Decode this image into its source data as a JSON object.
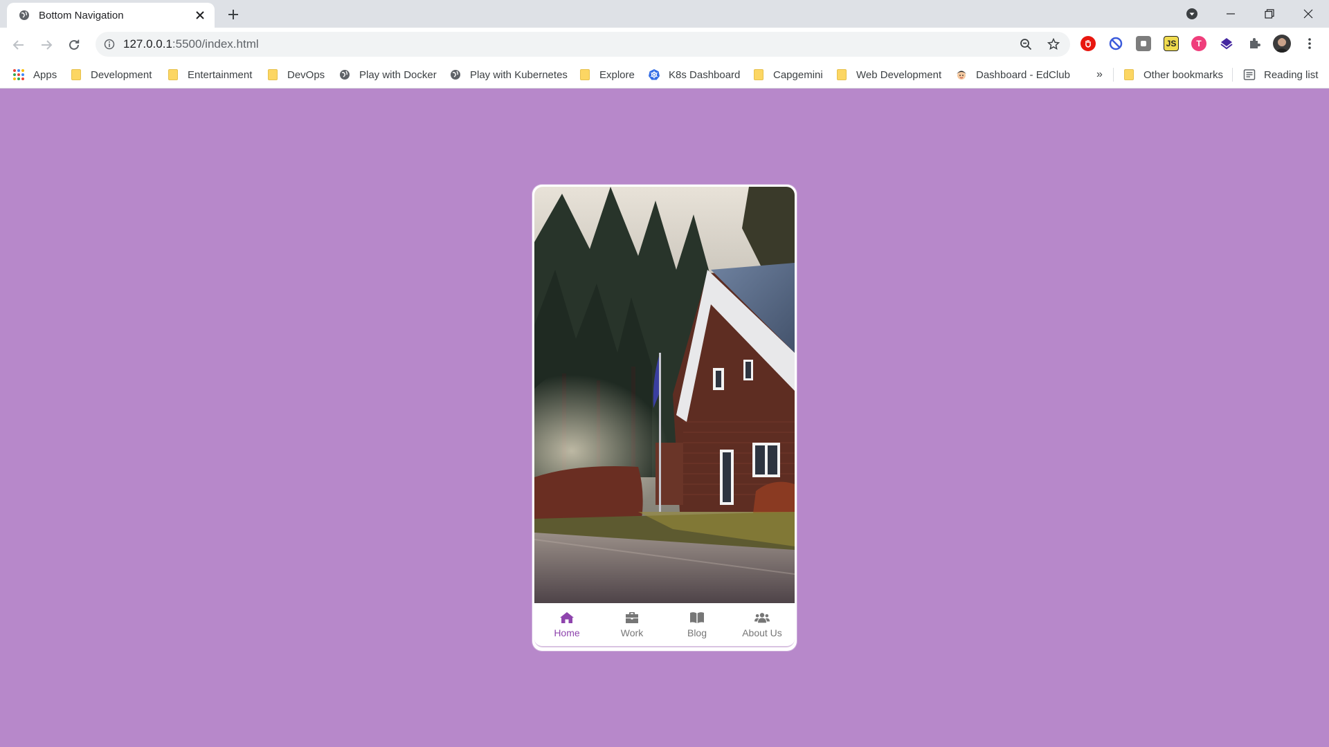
{
  "browser": {
    "tab_title": "Bottom Navigation",
    "url_host": "127.0.0.1",
    "url_rest": ":5500/index.html",
    "extensions": [
      "adblock-icon",
      "block-icon",
      "extension-grey-icon",
      "js-extension-icon",
      "t-extension-icon",
      "stack-extension-icon",
      "puzzle-icon",
      "profile-avatar"
    ],
    "bookmarks": [
      {
        "label": "Apps",
        "icon": "apps-grid-icon"
      },
      {
        "label": "Development",
        "icon": "folder-icon"
      },
      {
        "label": "Entertainment",
        "icon": "folder-icon"
      },
      {
        "label": "DevOps",
        "icon": "folder-icon"
      },
      {
        "label": "Play with Docker",
        "icon": "globe-icon"
      },
      {
        "label": "Play with Kubernetes",
        "icon": "globe-icon"
      },
      {
        "label": "Explore",
        "icon": "folder-icon"
      },
      {
        "label": "K8s Dashboard",
        "icon": "kubernetes-icon"
      },
      {
        "label": "Capgemini",
        "icon": "folder-icon"
      },
      {
        "label": "Web Development",
        "icon": "folder-icon"
      },
      {
        "label": "Dashboard - EdClub",
        "icon": "edclub-icon"
      }
    ],
    "overflow": "»",
    "other_bookmarks": "Other bookmarks",
    "reading_list": "Reading list"
  },
  "app": {
    "background_color": "#b788ca",
    "accent_color": "#8e44ad",
    "nav": [
      {
        "label": "Home",
        "icon": "home-icon",
        "active": true
      },
      {
        "label": "Work",
        "icon": "briefcase-icon",
        "active": false
      },
      {
        "label": "Blog",
        "icon": "book-icon",
        "active": false
      },
      {
        "label": "About Us",
        "icon": "users-icon",
        "active": false
      }
    ]
  }
}
